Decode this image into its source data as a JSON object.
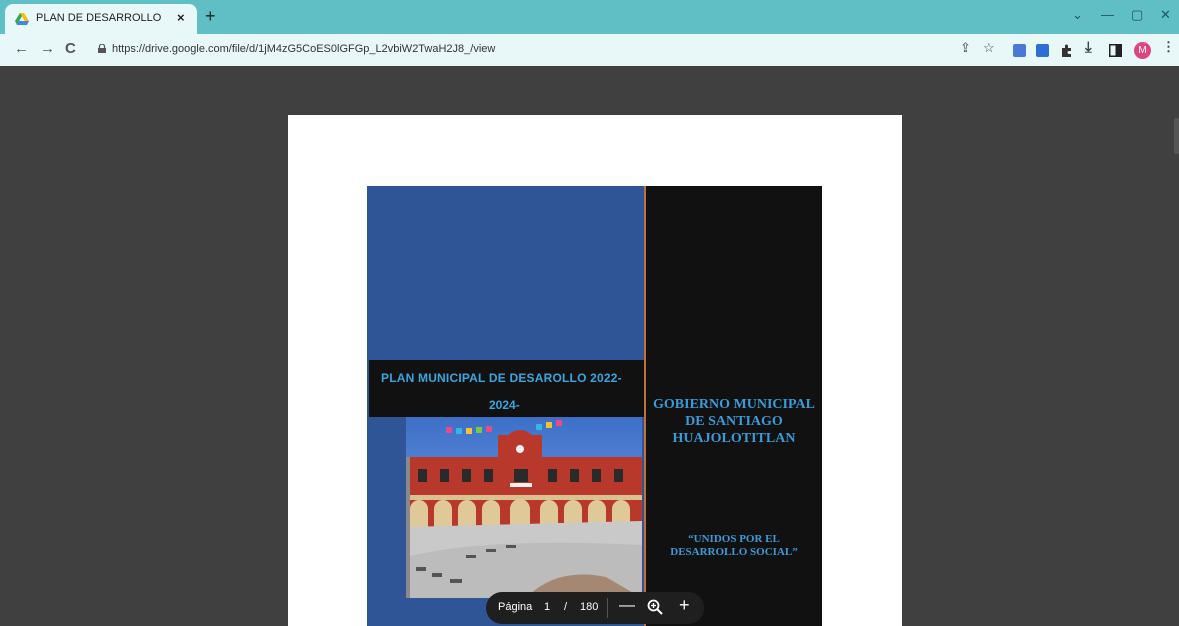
{
  "browser": {
    "tab": {
      "title": "PLAN DE DESARROLLO MUNICI",
      "close_glyph": "×",
      "favicon": "google-drive-icon"
    },
    "new_tab_glyph": "+",
    "window_controls": {
      "dropdown": "⌄",
      "minimize": "—",
      "restore": "▢",
      "close": "✕"
    },
    "nav": {
      "back": "←",
      "forward": "→",
      "reload": "C"
    },
    "url": "https://drive.google.com/file/d/1jM4zG5CoES0lGFGp_L2vbiW2TwaH2J8_/view",
    "toolbar_icons": {
      "share": "⇪",
      "bookmark": "☆",
      "download": "⤓",
      "menu": "⋮"
    },
    "profile_initial": "M"
  },
  "document": {
    "plan_title_line1": "PLAN  MUNICIPAL DE DESAROLLO  2022-",
    "plan_title_line2": "2024-",
    "government_lines": [
      "GOBIERNO MUNICIPAL",
      "DE SANTIAGO",
      "HUAJOLOTITLAN"
    ],
    "motto_lines": [
      "“UNIDOS POR EL",
      "DESARROLLO SOCIAL”"
    ]
  },
  "pager": {
    "label": "Página",
    "current": "1",
    "separator": "/",
    "total": "180",
    "minus": "—",
    "plus": "+"
  },
  "colors": {
    "tabstrip": "#5fbfc4",
    "cover_blue": "#2f5597",
    "cover_dark": "#111111",
    "title_text": "#39a6df",
    "viewer_bg": "#404040"
  }
}
